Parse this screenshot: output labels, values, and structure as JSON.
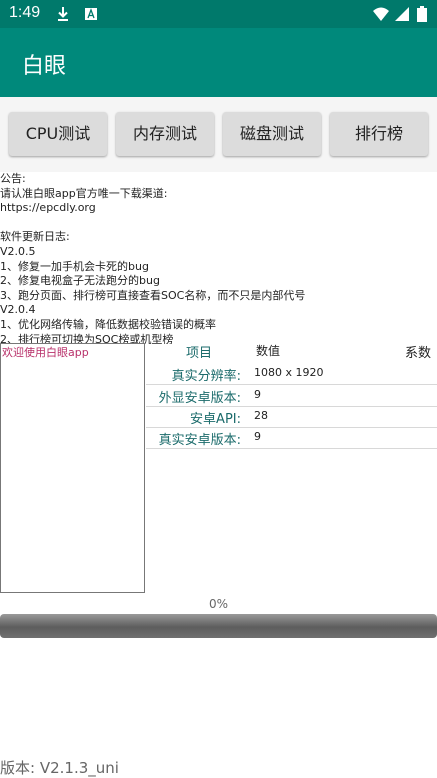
{
  "status_bar": {
    "time": "1:49",
    "icons": [
      "download-icon",
      "a-letter-icon",
      "wifi-icon",
      "signal-icon",
      "battery-icon"
    ]
  },
  "app_bar": {
    "title": "白眼"
  },
  "buttons": {
    "cpu": "CPU测试",
    "memory": "内存测试",
    "disk": "磁盘测试",
    "ranking": "排行榜"
  },
  "notice_lines": [
    "公告:",
    "请认准白眼app官方唯一下载渠道:",
    "https://epcdly.org",
    "",
    "软件更新日志:",
    "V2.0.5",
    "1、修复一加手机会卡死的bug",
    "2、修复电视盒子无法跑分的bug",
    "3、跑分页面、排行榜可直接查看SOC名称，而不只是内部代号",
    "V2.0.4",
    "1、优化网络传输，降低数据校验错误的概率",
    "2、排行榜可切换为SOC榜或机型榜"
  ],
  "welcome": {
    "text": "欢迎使用白眼app"
  },
  "info_table": {
    "headers": {
      "item": "项目",
      "value": "数值",
      "coefficient": "系数"
    },
    "rows": [
      {
        "label": "真实分辨率:",
        "value": "1080 x 1920"
      },
      {
        "label": "外显安卓版本:",
        "value": "9"
      },
      {
        "label": "安卓API:",
        "value": "28"
      },
      {
        "label": "真实安卓版本:",
        "value": "9"
      }
    ]
  },
  "progress": {
    "label": "0%",
    "value": 0
  },
  "footer": {
    "version": "版本: V2.1.3_uni"
  },
  "colors": {
    "status_bar": "#00796b",
    "app_bar": "#00897b",
    "welcome_text": "#b8306a",
    "label_teal": "#1b6b6b"
  }
}
